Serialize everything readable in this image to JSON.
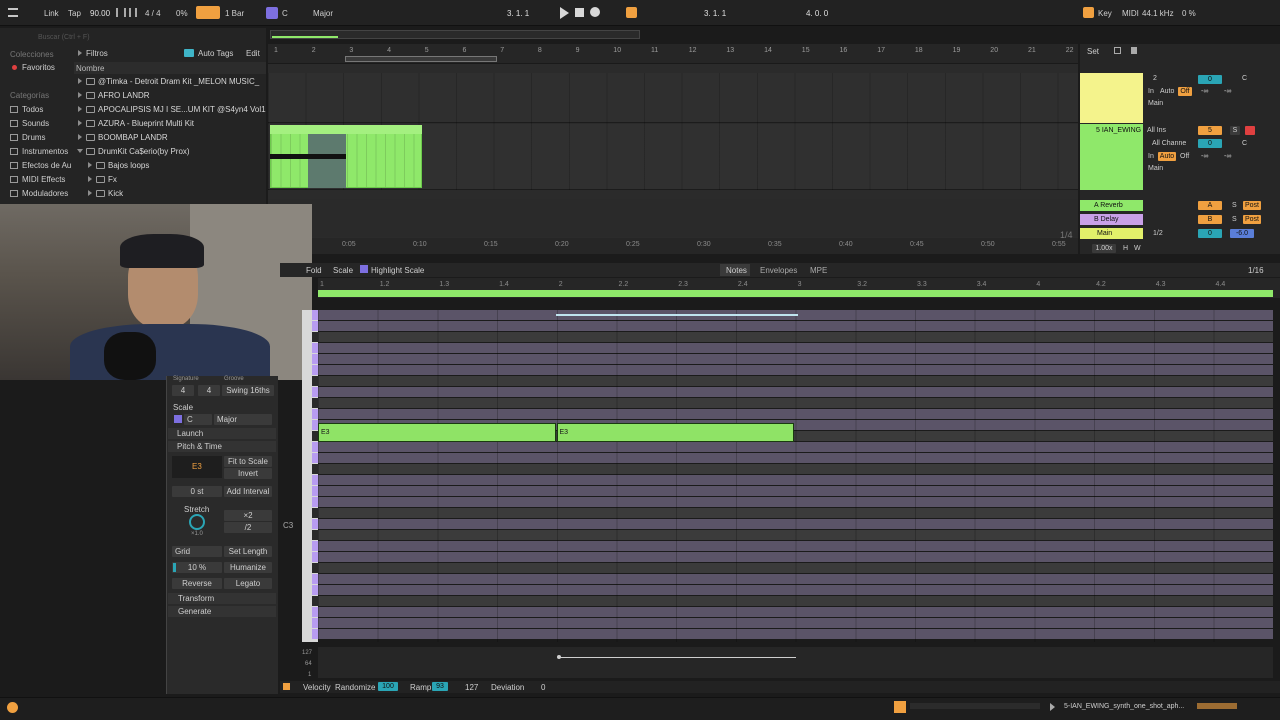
{
  "transport": {
    "link": "Link",
    "tap": "Tap",
    "tempo": "90.00",
    "signature": "4 / 4",
    "cpu": "0%",
    "quantize": "1 Bar",
    "key": "C",
    "scale": "Major",
    "position": "3.   1.   1",
    "loop_start": "3.   1.   1",
    "loop_length": "4.   0.   0",
    "key_label": "Key",
    "midi_label": "MIDI",
    "sample_rate": "44.1 kHz",
    "cpu_right": "0 %"
  },
  "browser": {
    "search_placeholder": "Buscar (Ctrl + F)",
    "collections_header": "Colecciones",
    "favorites": "Favoritos",
    "categories_header": "Categorías",
    "categories": [
      "Todos",
      "Sounds",
      "Drums",
      "Instrumentos",
      "Efectos de Au",
      "MIDI Effects",
      "Moduladores"
    ],
    "filters": "Filtros",
    "auto_tags": "Auto Tags",
    "edit": "Edit",
    "name_header": "Nombre",
    "items": [
      "@Timka - Detroit Dram Kit _MELON MUSIC_",
      "AFRO LANDR",
      "APOCALIPSIS MJ I SE...UM KIT @S4yn4 Vol1",
      "AZURA - Blueprint Multi Kit",
      "BOOMBAP LANDR",
      "DrumKit Ca$erio(by Prox)",
      "Bajos loops",
      "Fx",
      "Kick"
    ]
  },
  "arrangement": {
    "bar_numbers": [
      "1",
      "2",
      "3",
      "4",
      "5",
      "6",
      "7",
      "8",
      "9",
      "10",
      "11",
      "12",
      "13",
      "14",
      "15",
      "16",
      "17",
      "18",
      "19",
      "20",
      "21",
      "22"
    ],
    "time_labels": [
      "0:05",
      "0:10",
      "0:15",
      "0:20",
      "0:25",
      "0:30",
      "0:35",
      "0:40",
      "0:45",
      "0:50",
      "0:55"
    ],
    "loop_fraction": "1/4",
    "set_label": "Set"
  },
  "mixer": {
    "track1": {
      "input": "2",
      "in": "In",
      "auto": "Auto",
      "off": "Off",
      "output": "Main",
      "num": "0",
      "pan": "C",
      "vol": "-∞",
      "send": "-∞"
    },
    "track2": {
      "name": "5 IAN_EWING",
      "input": "All Ins",
      "channel": "All Channe",
      "in": "In",
      "auto": "Auto",
      "off": "Off",
      "output": "Main",
      "num": "5",
      "solo": "S",
      "vol_value": "0",
      "pan": "C",
      "vol": "-∞",
      "send": "-∞"
    },
    "returns": [
      {
        "name": "A Reverb",
        "letter": "A",
        "solo": "S",
        "post": "Post"
      },
      {
        "name": "B Delay",
        "letter": "B",
        "solo": "S",
        "post": "Post"
      }
    ],
    "main": {
      "name": "Main",
      "input": "1/2",
      "value": "0",
      "db": "-6.0"
    },
    "zoom": "1.00x",
    "h": "H",
    "w": "W"
  },
  "clip_props": {
    "signature_label": "Signature",
    "groove_label": "Groove",
    "sig_num": "4",
    "sig_den": "4",
    "groove_value": "Swing 16ths",
    "scale_label": "Scale",
    "scale_key": "C",
    "scale_mode": "Major",
    "launch": "Launch",
    "pitch_time": "Pitch & Time",
    "note": "E3",
    "fit_to_scale": "Fit to Scale",
    "invert": "Invert",
    "interval": "0 st",
    "add_interval": "Add Interval",
    "stretch": "Stretch",
    "stretch_value": "×1.0",
    "x2": "×2",
    "div2": "/2",
    "grid": "Grid",
    "set_length": "Set Length",
    "humanize_amount": "10 %",
    "humanize": "Humanize",
    "reverse": "Reverse",
    "legato": "Legato",
    "transform": "Transform",
    "generate": "Generate"
  },
  "piano_roll": {
    "fold": "Fold",
    "scale": "Scale",
    "highlight_scale": "Highlight Scale",
    "tabs": [
      "Notes",
      "Envelopes",
      "MPE"
    ],
    "grid_res": "1/16",
    "beats": [
      "1",
      "1.2",
      "1.3",
      "1.4",
      "2",
      "2.2",
      "2.3",
      "2.4",
      "3",
      "3.2",
      "3.3",
      "3.4",
      "4",
      "4.2",
      "4.3",
      "4.4"
    ],
    "c3_label": "C3",
    "notes": [
      {
        "label": "E3",
        "start_beat": 1.0,
        "length_beats": 1.0
      },
      {
        "label": "E3",
        "start_beat": 2.0,
        "length_beats": 1.0
      }
    ],
    "vel_max": "127",
    "vel_mid": "64",
    "vel_min": "1",
    "velocity_label": "Velocity",
    "randomize": "Randomize",
    "randomize_value": "100",
    "ramp": "Ramp",
    "ramp_value": "93",
    "ramp_end": "127",
    "deviation": "Deviation",
    "deviation_value": "0"
  },
  "status": {
    "track_name": "5-IAN_EWING_synth_one_shot_aph..."
  },
  "colors": {
    "clip_green": "#8fe86a",
    "track_yellow": "#f4f38c",
    "note_green": "#8fe366",
    "orange": "#f0a040",
    "purple_accent": "#7d6fe0"
  }
}
